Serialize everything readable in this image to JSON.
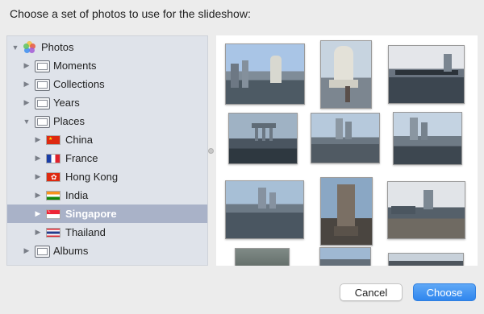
{
  "dialog": {
    "prompt": "Choose a set of photos to use for the slideshow:"
  },
  "sidebar": {
    "root": {
      "label": "Photos",
      "icon": "photos-app-icon"
    },
    "items": [
      {
        "label": "Moments",
        "icon": "folder-icon",
        "expanded": false
      },
      {
        "label": "Collections",
        "icon": "folder-icon",
        "expanded": false
      },
      {
        "label": "Years",
        "icon": "folder-icon",
        "expanded": false
      },
      {
        "label": "Places",
        "icon": "folder-icon",
        "expanded": true
      },
      {
        "label": "China",
        "icon": "china-flag-icon",
        "expanded": false
      },
      {
        "label": "France",
        "icon": "france-flag-icon",
        "expanded": false
      },
      {
        "label": "Hong Kong",
        "icon": "hong-kong-flag-icon",
        "expanded": false
      },
      {
        "label": "India",
        "icon": "india-flag-icon",
        "expanded": false
      },
      {
        "label": "Singapore",
        "icon": "singapore-flag-icon",
        "expanded": false,
        "selected": true
      },
      {
        "label": "Thailand",
        "icon": "thailand-flag-icon",
        "expanded": false
      },
      {
        "label": "Albums",
        "icon": "folder-icon",
        "expanded": false
      }
    ]
  },
  "photos": [
    {
      "name": "merlion-crowd"
    },
    {
      "name": "merlion-statue"
    },
    {
      "name": "river-bridge"
    },
    {
      "name": "marina-bay-sands"
    },
    {
      "name": "river-promenade"
    },
    {
      "name": "city-skyline-river"
    },
    {
      "name": "river-towers"
    },
    {
      "name": "cenotaph-monument"
    },
    {
      "name": "padang-field"
    },
    {
      "name": "stone-wall"
    },
    {
      "name": "tower-sky"
    },
    {
      "name": "building-corner"
    }
  ],
  "buttons": {
    "cancel": "Cancel",
    "choose": "Choose"
  },
  "colors": {
    "accent": "#2f86ee",
    "selection": "#a9b2c8",
    "sidebar_bg": "#dfe3ea"
  }
}
